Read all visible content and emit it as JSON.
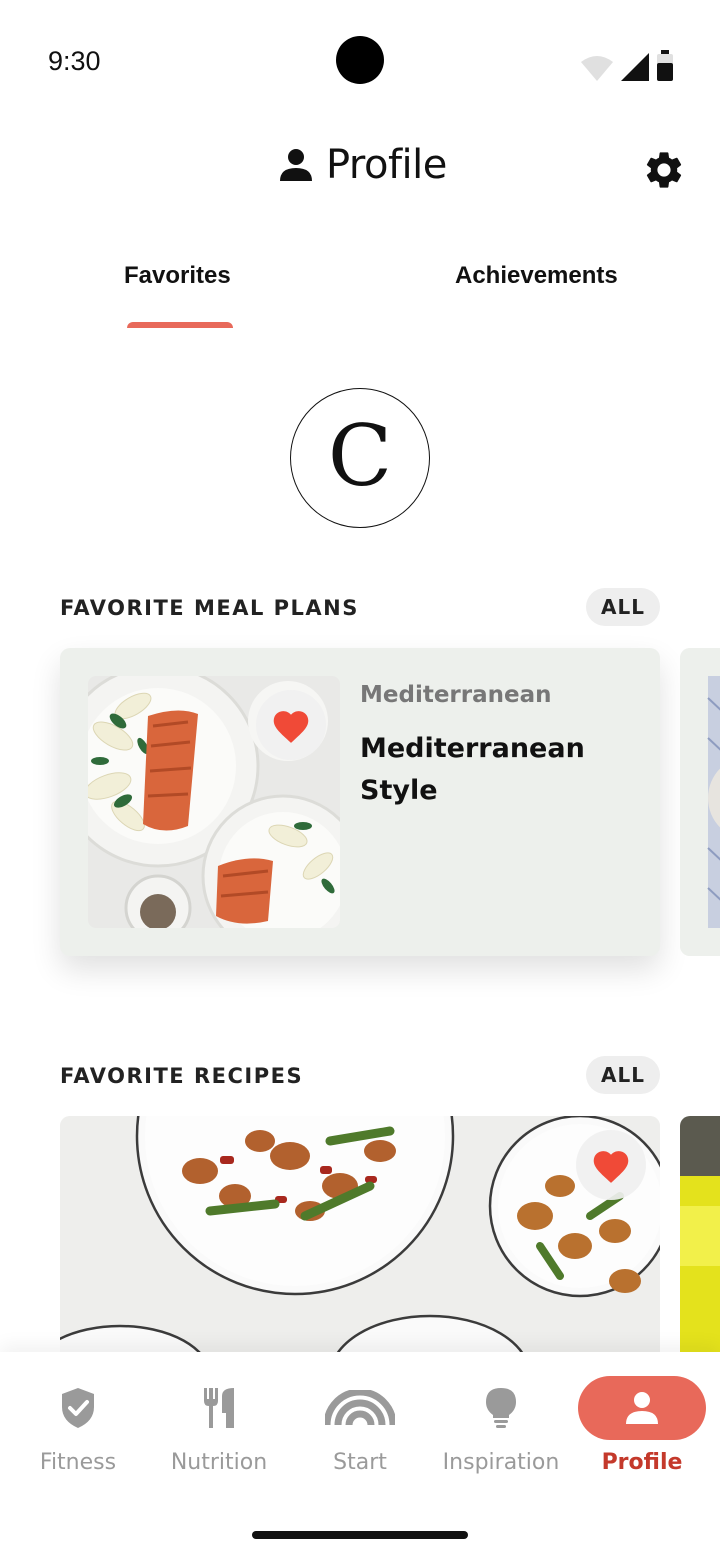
{
  "status_bar": {
    "time": "9:30",
    "icons": [
      "wifi-icon",
      "signal-icon",
      "battery-icon"
    ]
  },
  "header": {
    "title": "Profile",
    "title_icon": "person-icon",
    "settings_icon": "gear-icon"
  },
  "tabs": [
    {
      "label": "Favorites",
      "active": true
    },
    {
      "label": "Achievements",
      "active": false
    }
  ],
  "avatar": {
    "letter": "C"
  },
  "favorite_meal_plans": {
    "heading": "FAVORITE MEAL PLANS",
    "all_label": "ALL",
    "items": [
      {
        "category": "Mediterranean",
        "title": "Mediterranean Style",
        "favorited": true
      }
    ]
  },
  "favorite_recipes": {
    "heading": "FAVORITE RECIPES",
    "all_label": "ALL",
    "items": [
      {
        "favorited": true
      }
    ]
  },
  "bottom_nav": [
    {
      "label": "Fitness",
      "icon": "shield-check-icon",
      "active": false
    },
    {
      "label": "Nutrition",
      "icon": "fork-knife-icon",
      "active": false
    },
    {
      "label": "Start",
      "icon": "rainbow-icon",
      "active": false
    },
    {
      "label": "Inspiration",
      "icon": "lightbulb-icon",
      "active": false
    },
    {
      "label": "Profile",
      "icon": "person-icon",
      "active": true
    }
  ],
  "colors": {
    "accent": "#e8695a",
    "accent_text": "#c4392b",
    "card_bg": "#edf0ec",
    "heart": "#f04a37"
  }
}
